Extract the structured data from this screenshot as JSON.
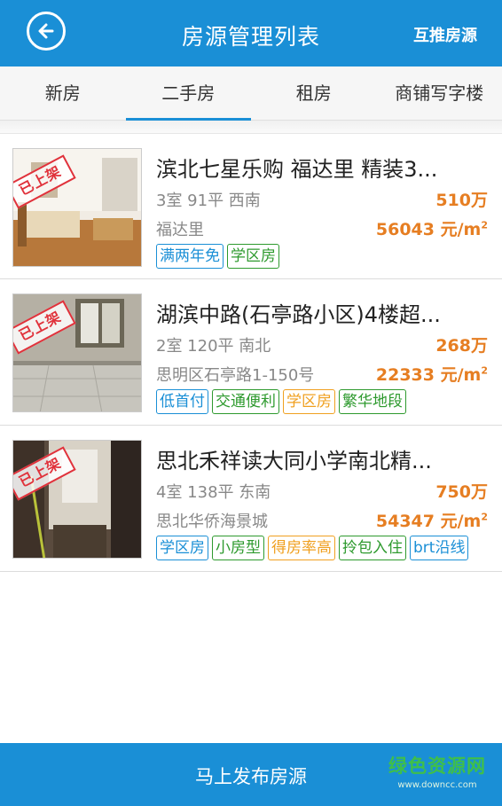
{
  "header": {
    "title": "房源管理列表",
    "action_label": "互推房源"
  },
  "tabs": [
    {
      "label": "新房"
    },
    {
      "label": "二手房"
    },
    {
      "label": "租房"
    },
    {
      "label": "商铺写字楼"
    }
  ],
  "active_tab": 1,
  "listings": [
    {
      "stamp": "已上架",
      "title": "滨北七星乐购 福达里 精装3...",
      "spec": "3室 91平 西南",
      "price": "510万",
      "location": "福达里",
      "unit_price": "56043 元/m",
      "unit_sup": "2",
      "tags": [
        {
          "label": "满两年免",
          "color": "blue"
        },
        {
          "label": "学区房",
          "color": "green"
        }
      ]
    },
    {
      "stamp": "已上架",
      "title": "湖滨中路(石亭路小区)4楼超...",
      "spec": "2室 120平 南北",
      "price": "268万",
      "location": "思明区石亭路1-150号",
      "unit_price": "22333 元/m",
      "unit_sup": "2",
      "tags": [
        {
          "label": "低首付",
          "color": "blue"
        },
        {
          "label": "交通便利",
          "color": "green"
        },
        {
          "label": "学区房",
          "color": "orange"
        },
        {
          "label": "繁华地段",
          "color": "green"
        }
      ]
    },
    {
      "stamp": "已上架",
      "title": "思北禾祥读大同小学南北精...",
      "spec": "4室 138平 东南",
      "price": "750万",
      "location": "思北华侨海景城",
      "unit_price": "54347 元/m",
      "unit_sup": "2",
      "tags": [
        {
          "label": "学区房",
          "color": "blue"
        },
        {
          "label": "小房型",
          "color": "green"
        },
        {
          "label": "得房率高",
          "color": "orange"
        },
        {
          "label": "拎包入住",
          "color": "green"
        },
        {
          "label": "brt沿线",
          "color": "blue"
        }
      ]
    }
  ],
  "footer": {
    "label": "马上发布房源"
  },
  "watermark": {
    "top": "绿色资源网",
    "bottom": "www.downcc.com"
  },
  "colors": {
    "primary": "#1a8fd6",
    "price": "#e67e22",
    "stamp": "#e0323b",
    "tag_blue": "#1a8fd6",
    "tag_green": "#2e9a2e",
    "tag_orange": "#f0a020"
  }
}
